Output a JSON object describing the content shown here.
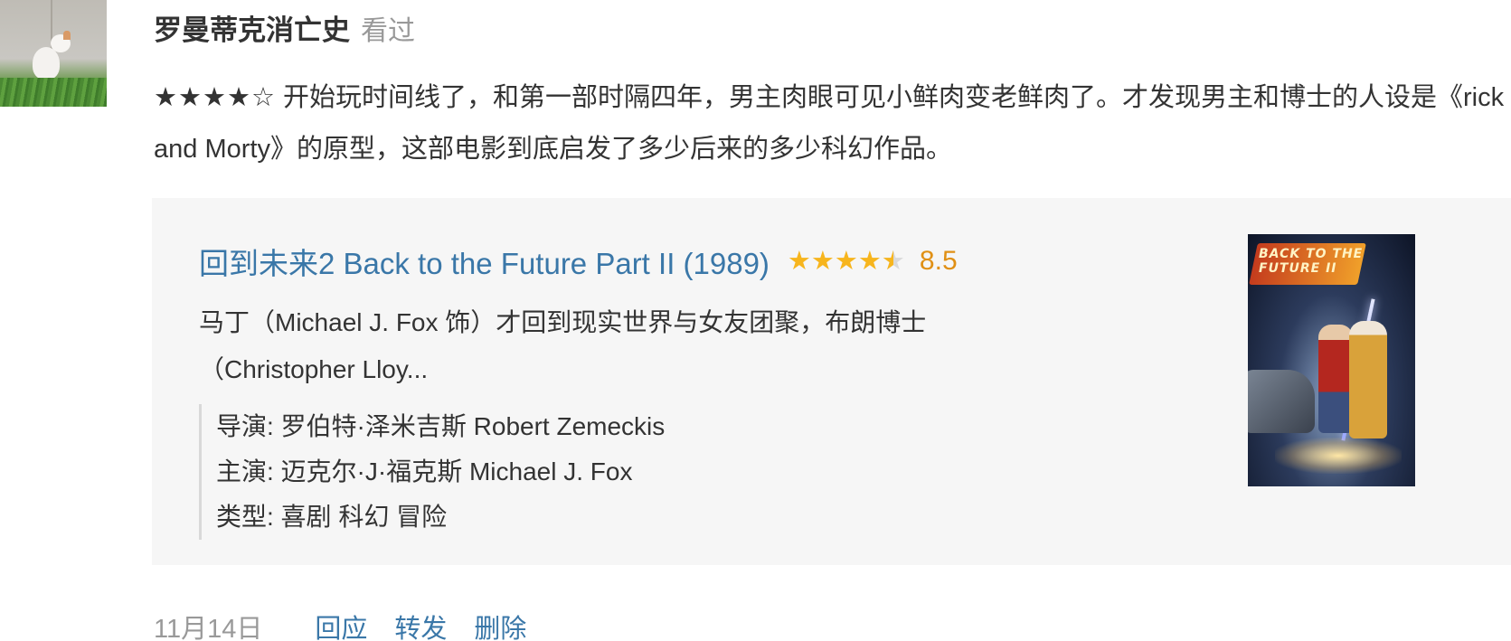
{
  "user": {
    "name": "罗曼蒂克消亡史",
    "status": "看过"
  },
  "comment": {
    "stars": "★★★★☆",
    "rating": 4,
    "rating_max": 5,
    "text": "开始玩时间线了，和第一部时隔四年，男主肉眼可见小鲜肉变老鲜肉了。才发现男主和博士的人设是《rick and Morty》的原型，这部电影到底启发了多少后来的多少科幻作品。"
  },
  "movie": {
    "title": "回到未来2 Back to the Future Part II (1989)",
    "rating_stars": 4.5,
    "rating_score": "8.5",
    "synopsis": "马丁（Michael J. Fox 饰）才回到现实世界与女友团聚，布朗博士（Christopher Lloy...",
    "director": "导演: 罗伯特·泽米吉斯 Robert Zemeckis",
    "cast": "主演: 迈克尔·J·福克斯 Michael J. Fox",
    "genre": "类型: 喜剧 科幻 冒险",
    "poster_logo": "BACK TO THE FUTURE II"
  },
  "footer": {
    "date": "11月14日",
    "reply": "回应",
    "share": "转发",
    "delete": "删除"
  },
  "colors": {
    "link": "#3a77a8",
    "star": "#f7b51d",
    "score": "#e09015",
    "muted": "#999999",
    "card_bg": "#f6f6f6"
  },
  "icons": {
    "avatar": "cat-photo-avatar",
    "poster": "movie-poster-image"
  }
}
